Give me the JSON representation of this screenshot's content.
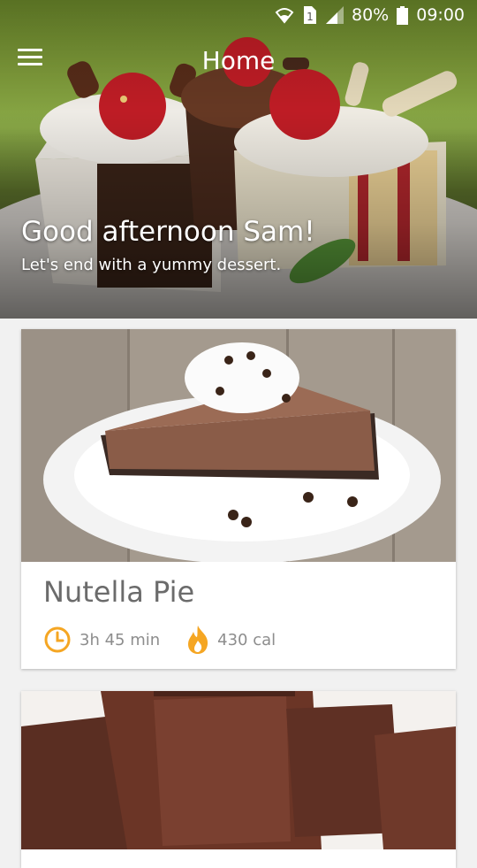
{
  "status_bar": {
    "battery": "80%",
    "time": "09:00"
  },
  "header": {
    "title": "Home",
    "greeting": "Good afternoon Sam!",
    "subtitle": "Let's end with a yummy dessert."
  },
  "recipes": [
    {
      "name": "Nutella Pie",
      "time": "3h 45 min",
      "calories": "430 cal"
    },
    {
      "name": ""
    }
  ],
  "colors": {
    "accent": "#f5a623",
    "title_text": "#6b6b6b",
    "meta_text": "#8d8d8d"
  },
  "icons": {
    "menu": "menu-icon",
    "time": "clock-icon",
    "calories": "flame-icon"
  }
}
